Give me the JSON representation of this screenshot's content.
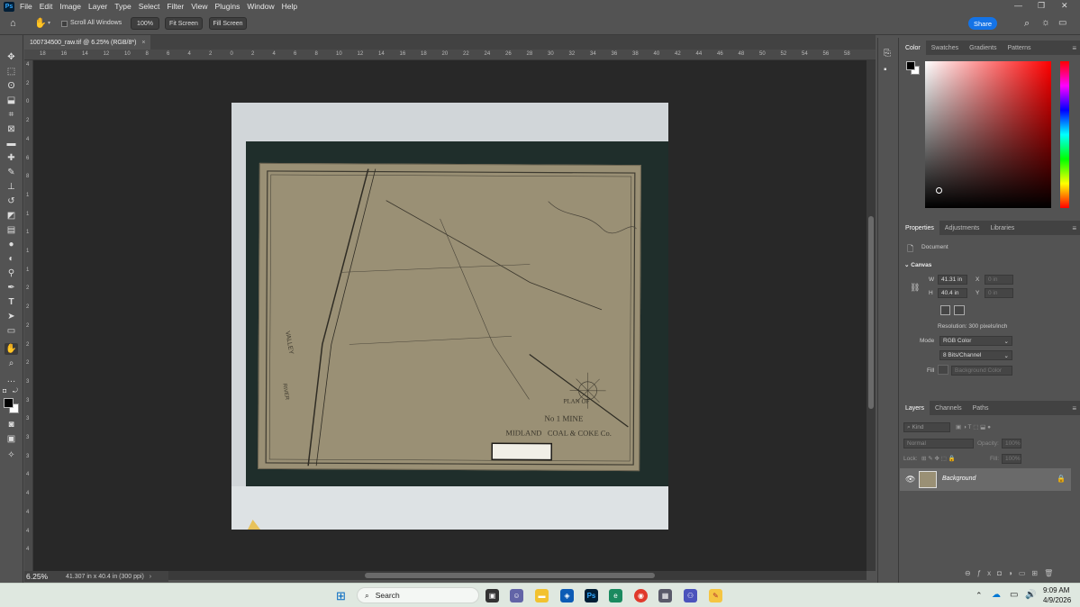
{
  "app": {
    "logo": "Ps"
  },
  "menu": [
    "File",
    "Edit",
    "Image",
    "Layer",
    "Type",
    "Select",
    "Filter",
    "View",
    "Plugins",
    "Window",
    "Help"
  ],
  "options": {
    "scroll_all": "Scroll All Windows",
    "zoom_btn": "100%",
    "fit_btn": "Fit Screen",
    "fill_btn": "Fill Screen",
    "share": "Share"
  },
  "document": {
    "tab_title": "100734500_raw.tif @ 6.25% (RGB/8*)",
    "zoom": "6.25%",
    "status": "41.307 in x 40.4 in (300 ppi)"
  },
  "ruler_top": [
    "18",
    "16",
    "14",
    "12",
    "10",
    "8",
    "6",
    "4",
    "2",
    "0",
    "2",
    "4",
    "6",
    "8",
    "10",
    "12",
    "14",
    "16",
    "18",
    "20",
    "22",
    "24",
    "26",
    "28",
    "30",
    "32",
    "34",
    "36",
    "38",
    "40",
    "42",
    "44",
    "46",
    "48",
    "50",
    "52",
    "54",
    "56",
    "58"
  ],
  "ruler_left": [
    "4",
    "2",
    "0",
    "2",
    "4",
    "6",
    "8",
    "1",
    "1",
    "1",
    "1",
    "1",
    "2",
    "2",
    "2",
    "2",
    "2",
    "3",
    "3",
    "3",
    "3",
    "3",
    "4",
    "4",
    "4",
    "4",
    "4"
  ],
  "map_text": {
    "title_line1": "PLAN OF",
    "title_line2": "No 1 MINE",
    "title_line3": "MIDLAND   COAL & COKE Co.",
    "valley": "VALLEY",
    "river": "RIVER"
  },
  "color_panel": {
    "tabs": [
      "Color",
      "Swatches",
      "Gradients",
      "Patterns"
    ]
  },
  "properties_panel": {
    "tabs": [
      "Properties",
      "Adjustments",
      "Libraries"
    ],
    "doc_label": "Document",
    "section": "Canvas",
    "w_label": "W",
    "w_value": "41.31 in",
    "h_label": "H",
    "h_value": "40.4 in",
    "x_label": "X",
    "x_value": "0 in",
    "y_label": "Y",
    "y_value": "0 in",
    "resolution": "Resolution: 300 pixels/inch",
    "mode_label": "Mode",
    "mode_value": "RGB Color",
    "bits_value": "8 Bits/Channel",
    "fill_label": "Fill",
    "fill_value": "Background Color"
  },
  "layers_panel": {
    "tabs": [
      "Layers",
      "Channels",
      "Paths"
    ],
    "kind": "Kind",
    "blend": "Normal",
    "opacity_label": "Opacity:",
    "opacity_value": "100%",
    "lock_label": "Lock:",
    "fill_label": "Fill:",
    "fill_value": "100%",
    "layer_name": "Background"
  },
  "taskbar": {
    "search": "Search",
    "time": "9:09 AM",
    "date": "4/9/2026"
  }
}
